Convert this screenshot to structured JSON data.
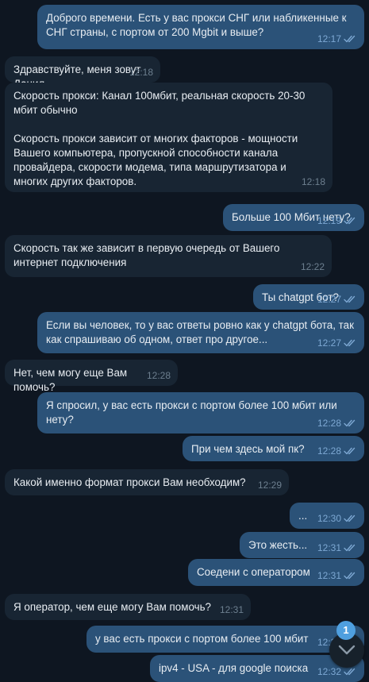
{
  "messages": [
    {
      "dir": "out",
      "text": "Доброго времени. Есть у вас прокси СНГ или набликенные к\nСНГ страны, с портом от 200 Mgbit и выше?",
      "time": "12:17",
      "read": true
    },
    {
      "dir": "in",
      "text": "Здравствуйте, меня зовут Данил",
      "time": "12:18"
    },
    {
      "dir": "in",
      "text": "Скорость прокси: Канал 100мбит, реальная скорость 20-30\nмбит обычно\n\nСкорость прокси зависит от многих факторов - мощности\nВашего компьютера, пропускной способности канала\nпровайдера, скорости модема, типа маршрутизатора и\nмногих других факторов.",
      "time": "12:18"
    },
    {
      "dir": "out",
      "text": "Больше 100 Мбит нету?",
      "time": "12:19",
      "read": true
    },
    {
      "dir": "in",
      "text": "Скорость так же зависит в первую очередь от Вашего\nинтернет подключения",
      "time": "12:22"
    },
    {
      "dir": "out",
      "text": "Ты chatgpt бот?",
      "time": "12:27",
      "read": true
    },
    {
      "dir": "out",
      "text": "Если вы человек, то у вас ответы ровно как у chatgpt бота, так\nкак спрашиваю об одном, ответ про другое...",
      "time": "12:27",
      "read": true
    },
    {
      "dir": "in",
      "text": "Нет, чем могу еще Вам помочь?",
      "time": "12:28"
    },
    {
      "dir": "out",
      "text": "Я спросил, у вас есть прокси с портом более 100 мбит или\nнету?",
      "time": "12:28",
      "read": true
    },
    {
      "dir": "out",
      "text": "При чем здесь мой пк?",
      "time": "12:28",
      "read": true
    },
    {
      "dir": "in",
      "text": "Какой именно формат прокси Вам необходим?",
      "time": "12:29"
    },
    {
      "dir": "out",
      "text": "...",
      "time": "12:30",
      "read": true
    },
    {
      "dir": "out",
      "text": "Это жесть...",
      "time": "12:31",
      "read": true
    },
    {
      "dir": "out",
      "text": "Соедени с оператором",
      "time": "12:31",
      "read": true
    },
    {
      "dir": "in",
      "text": "Я оператор, чем еще могу Вам помочь?",
      "time": "12:31"
    },
    {
      "dir": "out",
      "text": "у вас есть прокси с портом более 100 мбит",
      "time": "12:32",
      "read": true
    },
    {
      "dir": "out",
      "text": "ipv4 - USA - для google поиска",
      "time": "12:32",
      "read": true
    }
  ],
  "scroll_button": {
    "icon": "chevron-down-icon",
    "unread_badge": "1"
  },
  "colors": {
    "background": "#0e1621",
    "incoming": "#182533",
    "outgoing": "#2b5278",
    "badge": "#4f9fdf"
  }
}
